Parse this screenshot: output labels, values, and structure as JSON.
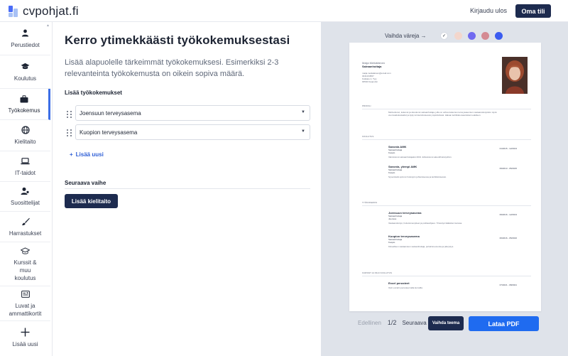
{
  "app": {
    "logo_text": "cvpohjat.fi"
  },
  "header": {
    "login_label": "Kirjaudu ulos",
    "account_label": "Oma tili"
  },
  "sidebar": {
    "items": [
      {
        "label": "Perustiedot",
        "icon": "person-icon"
      },
      {
        "label": "Koulutus",
        "icon": "graduation-cap-icon"
      },
      {
        "label": "Työkokemus",
        "icon": "briefcase-icon",
        "active": true
      },
      {
        "label": "Kielitaito",
        "icon": "globe-icon"
      },
      {
        "label": "IT-taidot",
        "icon": "laptop-icon"
      },
      {
        "label": "Suosittelijat",
        "icon": "people-icon"
      },
      {
        "label": "Harrastukset",
        "icon": "brush-icon"
      },
      {
        "label": "Kurssit & muu koulutus",
        "icon": "mortarboard-icon"
      },
      {
        "label": "Luvat ja ammattikortit",
        "icon": "id-card-icon"
      },
      {
        "label": "Lisää uusi",
        "icon": "plus-icon"
      }
    ]
  },
  "main": {
    "title": "Kerro ytimekkäästi työkokemuksestasi",
    "description": "Lisää alapuolelle tärkeimmät työkokemuksesi. Esimerkiksi 2-3 relevanteinta työkokemusta on oikein sopiva määrä.",
    "section_label": "Lisää työkokemukset",
    "jobs": [
      {
        "name": "Joensuun terveysasema"
      },
      {
        "name": "Kuopion terveysasema"
      }
    ],
    "add_new_label": "Lisää uusi",
    "next_step_label": "Seuraava vaihe",
    "next_button_label": "Lisää kielitaito"
  },
  "preview": {
    "color_label": "Vaihda väreja →",
    "colors": [
      "#ffffff",
      "#f3d6cc",
      "#e6b9b0",
      "#7069f0",
      "#d48a93",
      "#3b5cf0"
    ],
    "cv": {
      "name": "Maija Meikäläinen",
      "role": "Sairaanhoitaja",
      "contact": [
        "maija.meikalainen@email.com",
        "0441234567",
        "Kotikatu 2, Tyty",
        "00540 Kaupunki"
      ],
      "sections": {
        "profile": "PROFIILI",
        "education": "KOULUTUS",
        "experience": "TYÖKOKEMUS",
        "courses": "KURSSIT JA MUU KOULUTUS"
      },
      "profile_text": "Motivoitunut, kokenut ja sitoutunut sairaanhoitaja, jolla on vahva kokemus terveysasemien vastaanottotyöstä. Hyvä vuorovaikutustaidot ja kyky toimia kiireisessä ympäristössä. Haluan kehittää osaamistani edelleen.",
      "education": [
        {
          "title": "Savonia AMK",
          "sub": "Sairaanhoitaja\nKuopio",
          "date": "01/2015 - 12/2013",
          "text": "Valmistunut sairaanhoitajaksi 2013. Erikoistunut akuuttihoitotyöhön."
        },
        {
          "title": "Savonia, ylempi AMK",
          "sub": "Sairaanhoitaja\nKuopio",
          "date": "09/2013 - 05/2015",
          "text": "Syventävät opinnot hoitotyön johtamisessa ja kehittämisessä."
        }
      ],
      "experience": [
        {
          "title": "Joensuun terveysasema",
          "sub": "Sairaanhoitaja\nJoensuu",
          "date": "09/2016 - 12/2013",
          "text": "Vastaanottotyö, hoitotoimenpiteet ja potilasohjaus. Yhteistyö lääkärien kanssa."
        },
        {
          "title": "Kuopion terveysasema",
          "sub": "Sairaanhoitaja\nKuopio",
          "date": "06/2016 - 05/2016",
          "text": "Kiireellisen vastaanoton sairaanhoitaja, puhelinneuvonta ja päivystys."
        }
      ],
      "courses": [
        {
          "title": "Excel perusteet",
          "date": "07/2021 - 08/2021",
          "text": "Opin excelin perusteet talla kurssilla"
        }
      ]
    },
    "pager": {
      "prev_label": "Edellinen",
      "page": "1/2",
      "next_label": "Seuraava"
    },
    "theme_button_label": "Vaihda teema",
    "pdf_button_label": "Lataa PDF"
  }
}
